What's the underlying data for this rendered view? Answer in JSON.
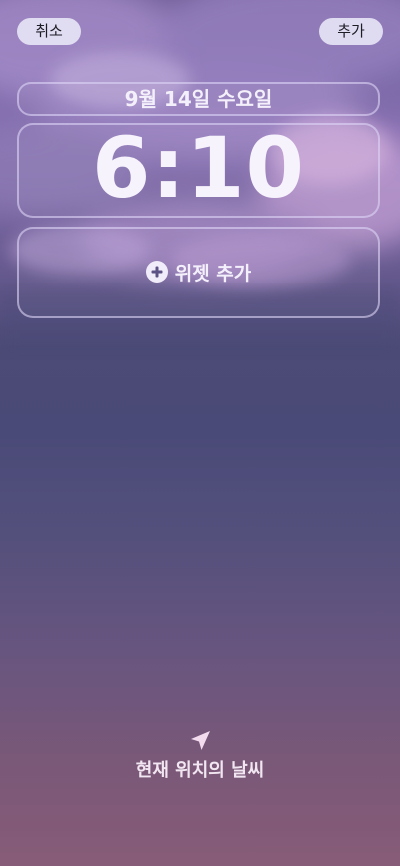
{
  "header": {
    "cancel_label": "취소",
    "add_label": "추가"
  },
  "lockscreen": {
    "date": "9월 14일 수요일",
    "time": "6:10",
    "widget_add_label": "위젯 추가"
  },
  "weather": {
    "label": "현재 위치의 날씨",
    "icon": "location-arrow-icon"
  },
  "colors": {
    "button_bg": "#e6e4f5",
    "text_light": "#f4f0fb",
    "frame_border": "#dcd4f5"
  }
}
